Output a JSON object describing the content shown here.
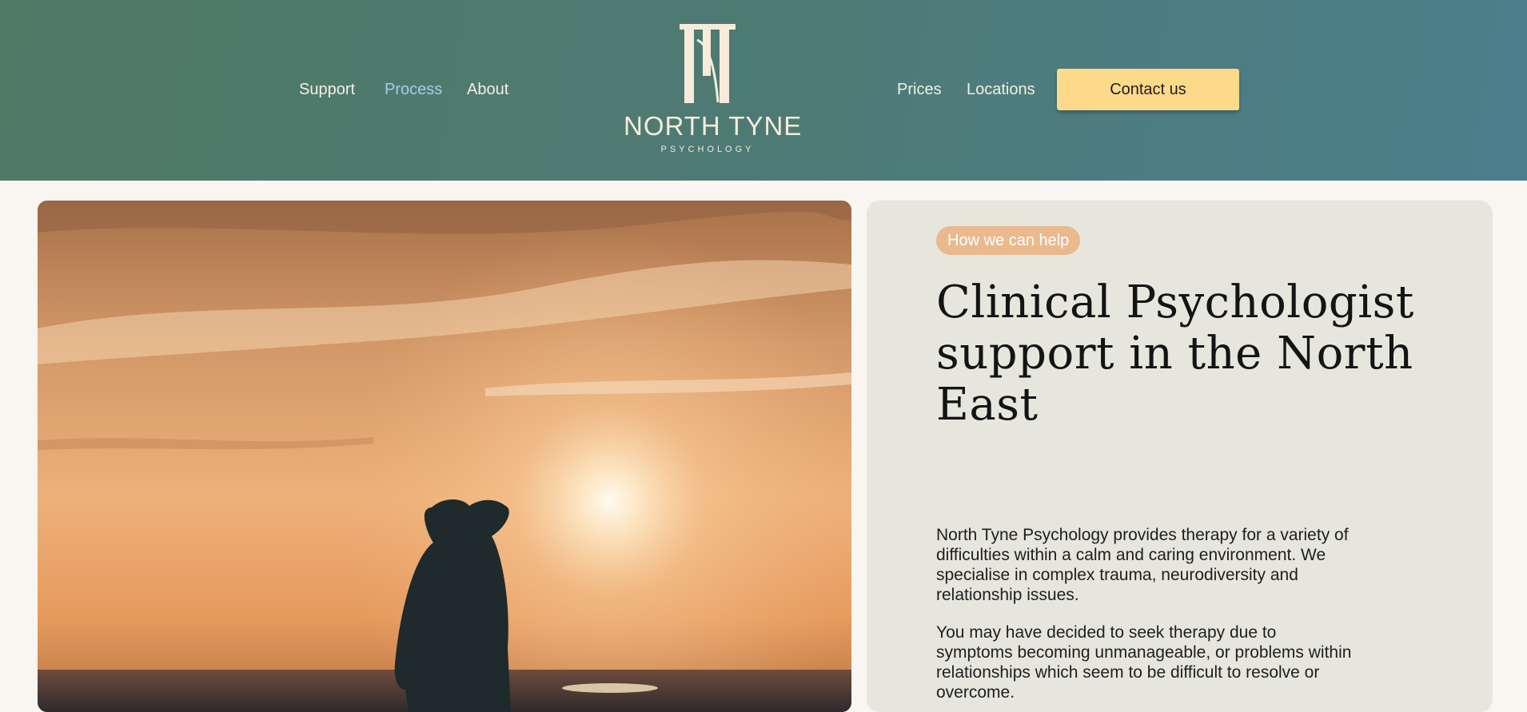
{
  "header": {
    "nav_left": [
      "Support",
      "Process",
      "About"
    ],
    "nav_right": [
      "Prices",
      "Locations"
    ],
    "active_item": "Process",
    "cta_label": "Contact us",
    "logo": {
      "name": "NORTH TYNE",
      "subtitle": "PSYCHOLOGY"
    }
  },
  "hero": {
    "image_description": "silhouette of a person shading eyes looking toward sunset over the sea"
  },
  "info": {
    "tag": "How we can help",
    "headline": "Clinical Psychologist support in the North East",
    "paragraphs": [
      "North Tyne Psychology provides therapy for a variety of difficulties within a calm and caring environment.  We specialise in complex trauma, neurodiversity and relationship issues.",
      "You may have decided to seek therapy due to symptoms becoming unmanageable, or problems within relationships which seem to be difficult to resolve or overcome."
    ]
  },
  "colors": {
    "header_start": "#4f7a66",
    "header_end": "#4b7f8c",
    "cta_background": "#fdd98a",
    "active_nav": "#a9cbe6",
    "tag_background": "#eab98d",
    "card_background": "#e7e6dc",
    "page_background": "#f9f6f1"
  }
}
